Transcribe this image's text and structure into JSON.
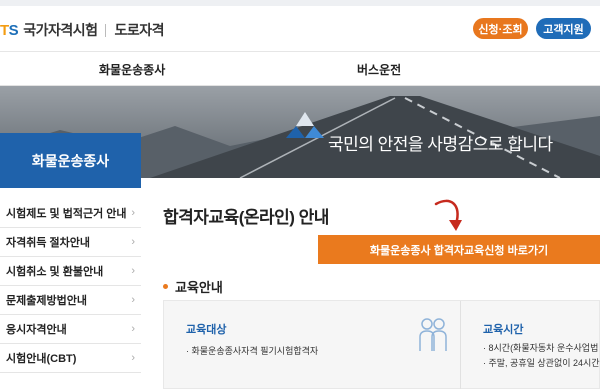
{
  "header": {
    "logo_mark_t": "T",
    "logo_mark_s": "S",
    "brand": "국가자격시험",
    "sub": "도로자격",
    "btn_apply": "신청·조회",
    "btn_support": "고객지원"
  },
  "gnb": {
    "items": [
      "화물운송종사",
      "버스운전"
    ]
  },
  "banner": {
    "slogan": "국민의 안전을 사명감으로 합니다"
  },
  "lnb": {
    "title": "화물운송종사",
    "items": [
      {
        "label": "시험제도 및 법적근거 안내"
      },
      {
        "label": "자격취득 절차안내"
      },
      {
        "label": "시험취소 및 환불안내"
      },
      {
        "label": "문제출제방법안내"
      },
      {
        "label": "응시자격안내"
      },
      {
        "label": "시험안내(CBT)"
      }
    ]
  },
  "main": {
    "title": "합격자교육(온라인) 안내",
    "cta": "화물운송종사 합격자교육신청 바로가기",
    "section_title": "교육안내",
    "cards": [
      {
        "title": "교육대상",
        "lines": [
          "· 화물운송종사자격 필기시험합격자"
        ]
      },
      {
        "title": "교육시간",
        "lines": [
          "· 8시간(화물자동차 운수사업법 시",
          "· 주말, 공휴일 상관없이 24시간 본"
        ]
      }
    ]
  },
  "colors": {
    "accent": "#ea7a1e",
    "brand": "#1f62ab"
  },
  "icons": {
    "chevron": "chevron-right-icon",
    "people": "people-icon"
  }
}
